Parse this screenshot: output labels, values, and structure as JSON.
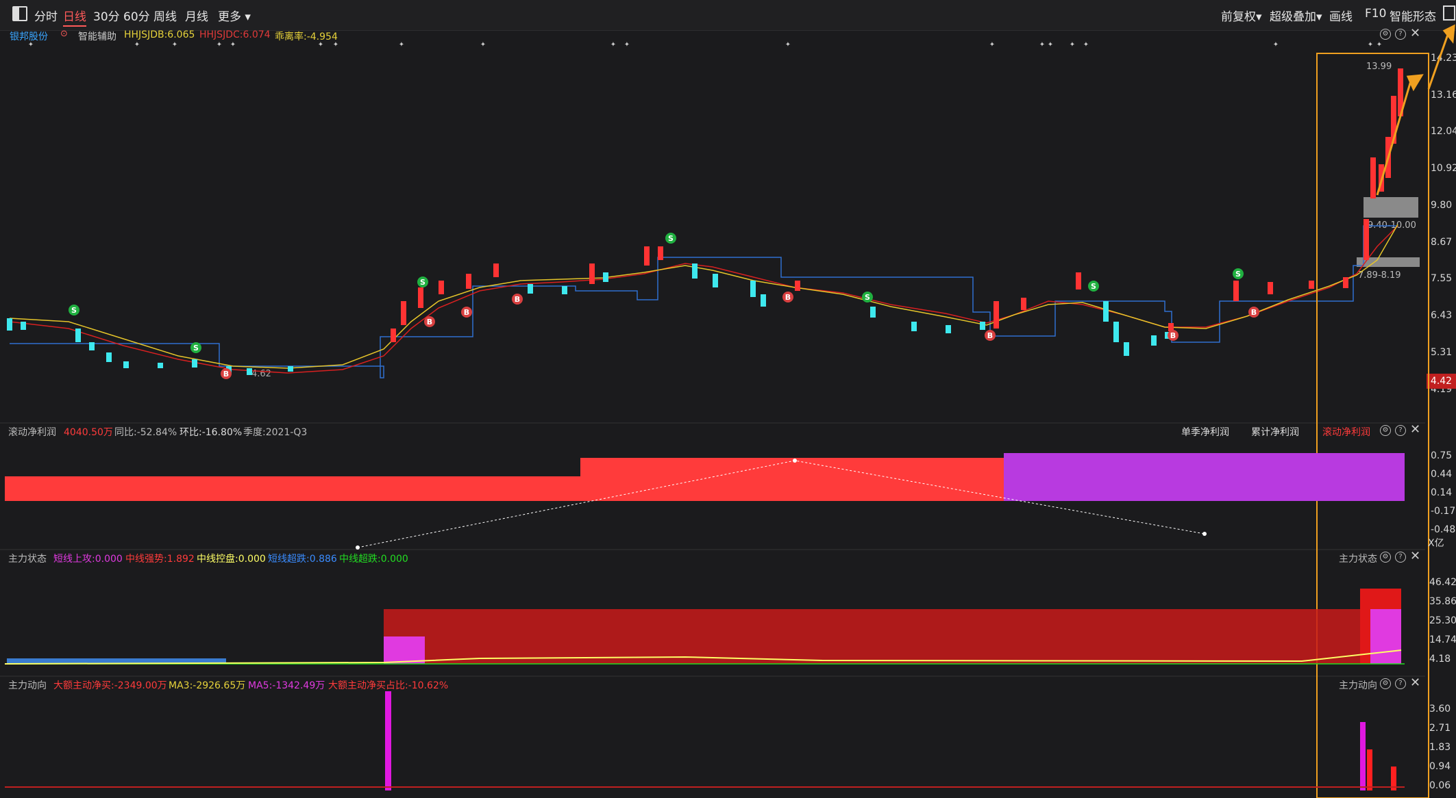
{
  "toolbar": {
    "tabs": [
      "分时",
      "日线",
      "30分",
      "60分",
      "周线",
      "月线",
      "更多"
    ],
    "active_tab": "日线",
    "right_items": [
      "前复权",
      "超级叠加",
      "画线",
      "F10",
      "智能形态"
    ]
  },
  "main_panel": {
    "stock_name": "银邦股份",
    "assist_label": "智能辅助",
    "indicators": [
      {
        "text": "HHJSJDB:6.065",
        "color": "#e6d23a"
      },
      {
        "text": "HHJSJDC:6.074",
        "color": "#e03a3a"
      },
      {
        "text": "乖离率:-4.954",
        "color": "#e6d23a"
      }
    ],
    "y_axis": [
      "14.23",
      "13.16",
      "12.04",
      "10.92",
      "9.80",
      "8.67",
      "7.55",
      "6.43",
      "5.31",
      "4.19"
    ],
    "current_price_tag": "4.42",
    "annotations": {
      "high": "13.99",
      "zone_high": "9.40-10.00",
      "zone_low": "7.89-8.19",
      "low": "4.62"
    }
  },
  "profit_panel": {
    "title": "滚动净利润",
    "value": "4040.50万",
    "yoy": "同比:-52.84%",
    "qoq": "环比:-16.80%",
    "quarter": "季度:2021-Q3",
    "right_tabs": [
      "单季净利润",
      "累计净利润",
      "滚动净利润"
    ],
    "y_axis": [
      "0.75",
      "0.44",
      "0.14",
      "-0.17",
      "-0.48"
    ],
    "unit": "X亿"
  },
  "force_panel": {
    "title": "主力状态",
    "items": [
      {
        "text": "短线上攻:0.000",
        "color": "#e03ae0"
      },
      {
        "text": "中线强势:1.892",
        "color": "#ff3b3b"
      },
      {
        "text": "中线控盘:0.000",
        "color": "#ffff66"
      },
      {
        "text": "短线超跌:0.886",
        "color": "#3a8cff"
      },
      {
        "text": "中线超跌:0.000",
        "color": "#22dd22"
      }
    ],
    "right_title": "主力状态",
    "y_axis": [
      "46.42",
      "35.86",
      "25.30",
      "14.74",
      "4.18"
    ]
  },
  "flow_panel": {
    "title": "主力动向",
    "items": [
      {
        "text": "大额主动净买:-2349.00万",
        "color": "#ff3b3b"
      },
      {
        "text": "MA3:-2926.65万",
        "color": "#e6d23a"
      },
      {
        "text": "MA5:-1342.49万",
        "color": "#e03ae0"
      },
      {
        "text": "大额主动净买占比:-10.62%",
        "color": "#ff3b3b"
      }
    ],
    "right_title": "主力动向",
    "y_axis": [
      "3.60",
      "2.71",
      "1.83",
      "0.94",
      "0.06"
    ]
  },
  "colors": {
    "up": "#ff3333",
    "down": "#3ee8ee",
    "highlight_box": "#f0a020",
    "bg": "#1b1b1d"
  }
}
